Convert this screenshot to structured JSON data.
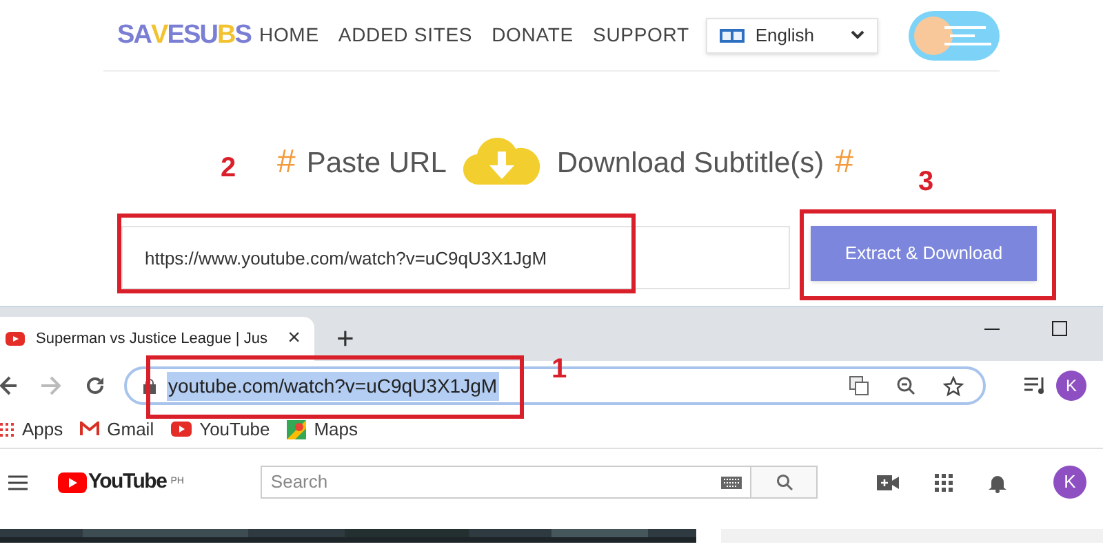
{
  "site": {
    "logo": [
      {
        "text": "SA",
        "color": "#7b7fd4"
      },
      {
        "text": "V",
        "color": "#f2c230"
      },
      {
        "text": "E",
        "color": "#7b7fd4"
      },
      {
        "text": "SU",
        "color": "#7b7fd4"
      },
      {
        "text": "B",
        "color": "#f2c230"
      },
      {
        "text": "S",
        "color": "#7b7fd4"
      }
    ],
    "nav": [
      "HOME",
      "ADDED SITES",
      "DONATE",
      "SUPPORT"
    ],
    "language": "English",
    "toggle": {
      "on": false
    },
    "headline": {
      "hash_left": "#",
      "step_one": "Paste URL",
      "step_two": "Download Subtitle(s)",
      "hash_right": "#"
    },
    "url_field": {
      "value": "https://www.youtube.com/watch?v=uC9qU3X1JgM"
    },
    "button": "Extract & Download"
  },
  "annotations": [
    {
      "label": "1"
    },
    {
      "label": "2"
    },
    {
      "label": "3"
    }
  ],
  "browser": {
    "tab": {
      "title": "Superman vs Justice League | Jus",
      "close": "×"
    },
    "new_tab": "+",
    "address": {
      "value": "youtube.com/watch?v=uC9qU3X1JgM",
      "selected": true
    },
    "avatar": "K",
    "bookmarks": [
      "Apps",
      "Gmail",
      "YouTube",
      "Maps"
    ]
  },
  "youtube": {
    "logo": "YouTube",
    "region": "PH",
    "search_placeholder": "Search",
    "avatar": "K"
  }
}
